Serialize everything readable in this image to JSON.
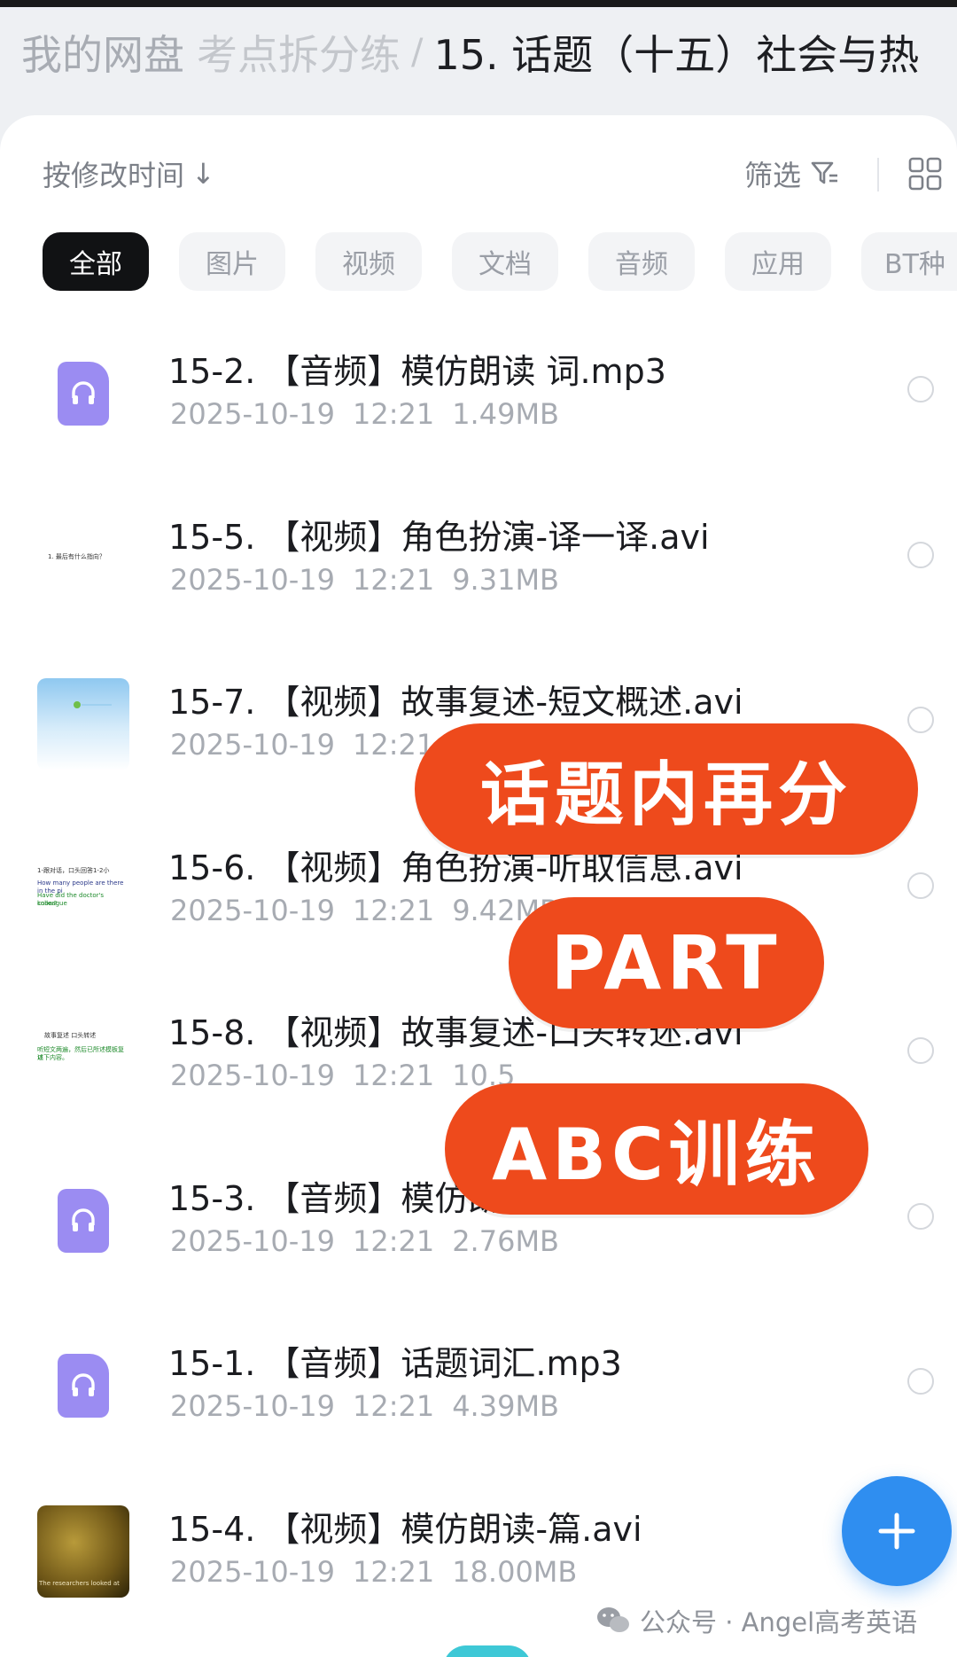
{
  "breadcrumb": {
    "items": [
      "我的网盘",
      "考点拆分练"
    ],
    "separator": "/",
    "current": "15. 话题（十五）社会与热"
  },
  "toolbar": {
    "sort_label": "按修改时间",
    "sort_arrow": "↓",
    "filter_label": "筛选",
    "filter_icon": "filter-icon",
    "view_icon": "grid-view-icon"
  },
  "categories": [
    "全部",
    "图片",
    "视频",
    "文档",
    "音频",
    "应用",
    "BT种"
  ],
  "active_category": "全部",
  "files": [
    {
      "name": "15-2. 【音频】模仿朗读 词.mp3",
      "date": "2025-10-19",
      "time": "12:21",
      "size": "1.49MB",
      "type": "audio"
    },
    {
      "name": "15-5. 【视频】角色扮演-译一译.avi",
      "date": "2025-10-19",
      "time": "12:21",
      "size": "9.31MB",
      "type": "video"
    },
    {
      "name": "15-7. 【视频】故事复述-短文概述.avi",
      "date": "2025-10-19",
      "time": "12:21",
      "size": "",
      "type": "video"
    },
    {
      "name": "15-6. 【视频】角色扮演-听取信息.avi",
      "date": "2025-10-19",
      "time": "12:21",
      "size": "9.42MB",
      "type": "video"
    },
    {
      "name": "15-8. 【视频】故事复述-口头转述.avi",
      "date": "2025-10-19",
      "time": "12:21",
      "size": "10.5",
      "type": "video"
    },
    {
      "name": "15-3. 【音频】模仿朗",
      "date": "2025-10-19",
      "time": "12:21",
      "size": "2.76MB",
      "type": "audio"
    },
    {
      "name": "15-1. 【音频】话题词汇.mp3",
      "date": "2025-10-19",
      "time": "12:21",
      "size": "4.39MB",
      "type": "audio"
    },
    {
      "name": "15-4. 【视频】模仿朗读-篇.avi",
      "date": "2025-10-19",
      "time": "12:21",
      "size": "18.00MB",
      "type": "video"
    }
  ],
  "thumb_text": {
    "t2": "1. 最后有什么指向？",
    "t4_line1": "1-跟对话，口头回答1-2小",
    "t4_line2": "How many people are there in the pi",
    "t4_line3": "Have did the doctor's colleague",
    "t4_line4": "know?",
    "t5_line1": "故事复述  口头转述",
    "t5_line2": "听短文两遍，然后已所述模板复述",
    "t5_line3": "以下内容。",
    "t8_caption": "The researchers looked at"
  },
  "overlay": {
    "line1": "话题内再分",
    "line2": "PART",
    "line3": "ABC训练"
  },
  "fab": {
    "icon": "plus-icon"
  },
  "watermark": {
    "text": "公众号 · Angel高考英语",
    "icon": "wechat-icon"
  },
  "colors": {
    "accent_red": "#ee4a1c",
    "fab_blue": "#2f8ef0",
    "audio_purple": "#9b8cf2",
    "active_chip": "#111214"
  }
}
